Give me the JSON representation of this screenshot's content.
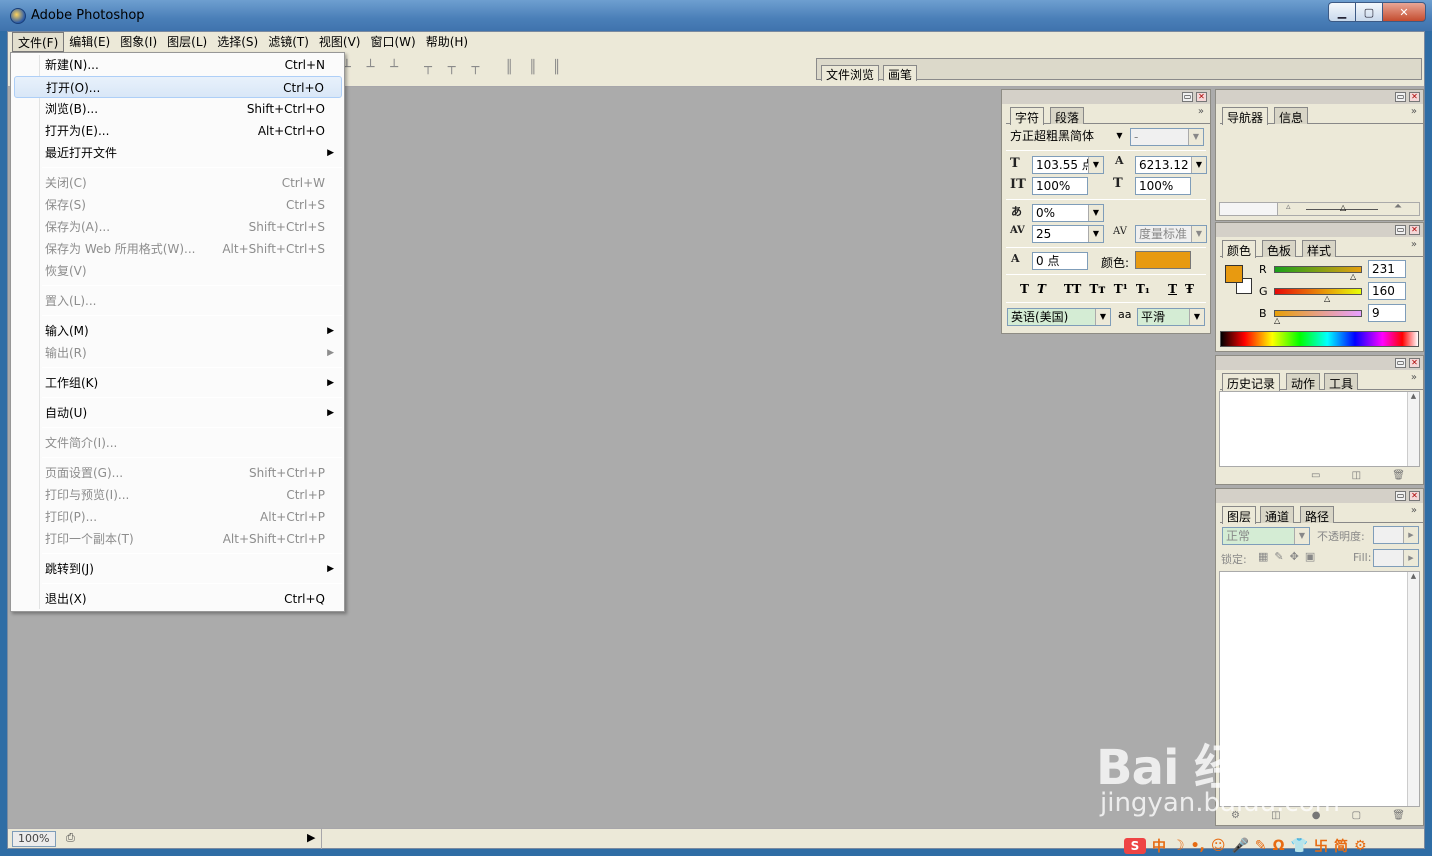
{
  "window": {
    "title": "Adobe Photoshop",
    "min": "▁",
    "max": "▢",
    "close": "✕"
  },
  "menubar": [
    "文件(F)",
    "编辑(E)",
    "图象(I)",
    "图层(L)",
    "选择(S)",
    "滤镜(T)",
    "视图(V)",
    "窗口(W)",
    "帮助(H)"
  ],
  "options_bar": {
    "align_groups": [
      "┴ ┴ ┴",
      "┬ ┬ ┬",
      "║ ║ ║"
    ],
    "well_tabs": [
      "文件浏览",
      "画笔"
    ]
  },
  "file_menu": {
    "items": [
      {
        "label": "新建(N)...",
        "shortcut": "Ctrl+N"
      },
      {
        "label": "打开(O)...",
        "shortcut": "Ctrl+O"
      },
      {
        "label": "浏览(B)...",
        "shortcut": "Shift+Ctrl+O"
      },
      {
        "label": "打开为(E)...",
        "shortcut": "Alt+Ctrl+O"
      },
      {
        "label": "最近打开文件",
        "shortcut": ""
      },
      {
        "label": "关闭(C)",
        "shortcut": "Ctrl+W"
      },
      {
        "label": "保存(S)",
        "shortcut": "Ctrl+S"
      },
      {
        "label": "保存为(A)...",
        "shortcut": "Shift+Ctrl+S"
      },
      {
        "label": "保存为 Web 所用格式(W)...",
        "shortcut": "Alt+Shift+Ctrl+S"
      },
      {
        "label": "恢复(V)",
        "shortcut": ""
      },
      {
        "label": "置入(L)...",
        "shortcut": ""
      },
      {
        "label": "输入(M)",
        "shortcut": ""
      },
      {
        "label": "输出(R)",
        "shortcut": ""
      },
      {
        "label": "工作组(K)",
        "shortcut": ""
      },
      {
        "label": "自动(U)",
        "shortcut": ""
      },
      {
        "label": "文件简介(I)...",
        "shortcut": ""
      },
      {
        "label": "页面设置(G)...",
        "shortcut": "Shift+Ctrl+P"
      },
      {
        "label": "打印与预览(I)...",
        "shortcut": "Ctrl+P"
      },
      {
        "label": "打印(P)...",
        "shortcut": "Alt+Ctrl+P"
      },
      {
        "label": "打印一个副本(T)",
        "shortcut": "Alt+Shift+Ctrl+P"
      },
      {
        "label": "跳转到(J)",
        "shortcut": ""
      },
      {
        "label": "退出(X)",
        "shortcut": "Ctrl+Q"
      }
    ],
    "submenu_arrow": "▶"
  },
  "character_panel": {
    "tabs": [
      "字符",
      "段落"
    ],
    "font_family": "方正超粗黑简体",
    "font_style": "-",
    "font_size": "103.55 点",
    "leading": "6213.12",
    "vertical_scale": "100%",
    "horizontal_scale": "100%",
    "tsume": "0%",
    "tracking": "25",
    "kerning": "度量标准",
    "baseline_shift": "0 点",
    "color_label": "颜色:",
    "color": "#e89a10",
    "style_buttons": [
      "T",
      "T",
      "TT",
      "Tт",
      "T¹",
      "T₁",
      "T",
      "Ŧ"
    ],
    "language": "英语(美国)",
    "antialias_icon": "aa",
    "antialias": "平滑",
    "icons": {
      "size": "T",
      "leading": "A",
      "vscale": "IT",
      "hscale": "T",
      "tsume": "あ",
      "tracking": "AV",
      "kerning": "AV",
      "baseline": "A"
    },
    "menu_icon": "»"
  },
  "navigator_panel": {
    "tabs": [
      "导航器",
      "信息"
    ],
    "menu_icon": "»",
    "zoom_small": "▵",
    "zoom_large": "⏶"
  },
  "color_panel": {
    "tabs": [
      "颜色",
      "色板",
      "样式"
    ],
    "foreground": "#e89a10",
    "background": "#ffffff",
    "channels": [
      {
        "name": "R",
        "value": "231"
      },
      {
        "name": "G",
        "value": "160"
      },
      {
        "name": "B",
        "value": "9"
      }
    ],
    "menu_icon": "»"
  },
  "history_panel": {
    "tabs": [
      "历史记录",
      "动作",
      "工具"
    ],
    "menu_icon": "»",
    "footer_icons": "▭ ◫ 🗑"
  },
  "layers_panel": {
    "tabs": [
      "图层",
      "通道",
      "路径"
    ],
    "blend_mode": "正常",
    "opacity_label": "不透明度:",
    "lock_label": "锁定:",
    "fill_label": "Fill:",
    "menu_icon": "»",
    "footer_icons": "⚙ ◫ ● ▢ 🗑"
  },
  "status_bar": {
    "zoom": "100%",
    "doc_icon": "⎙",
    "arrow": "▶"
  },
  "watermark": {
    "logo": "Bai  经验",
    "url": "jingyan.baidu.com"
  },
  "ime_bar": {
    "logo": "S",
    "items": [
      "中",
      "☽",
      "•,",
      "☺",
      "🎤",
      "✎",
      "Ω",
      "👕",
      "卐",
      "简",
      "⚙"
    ]
  }
}
